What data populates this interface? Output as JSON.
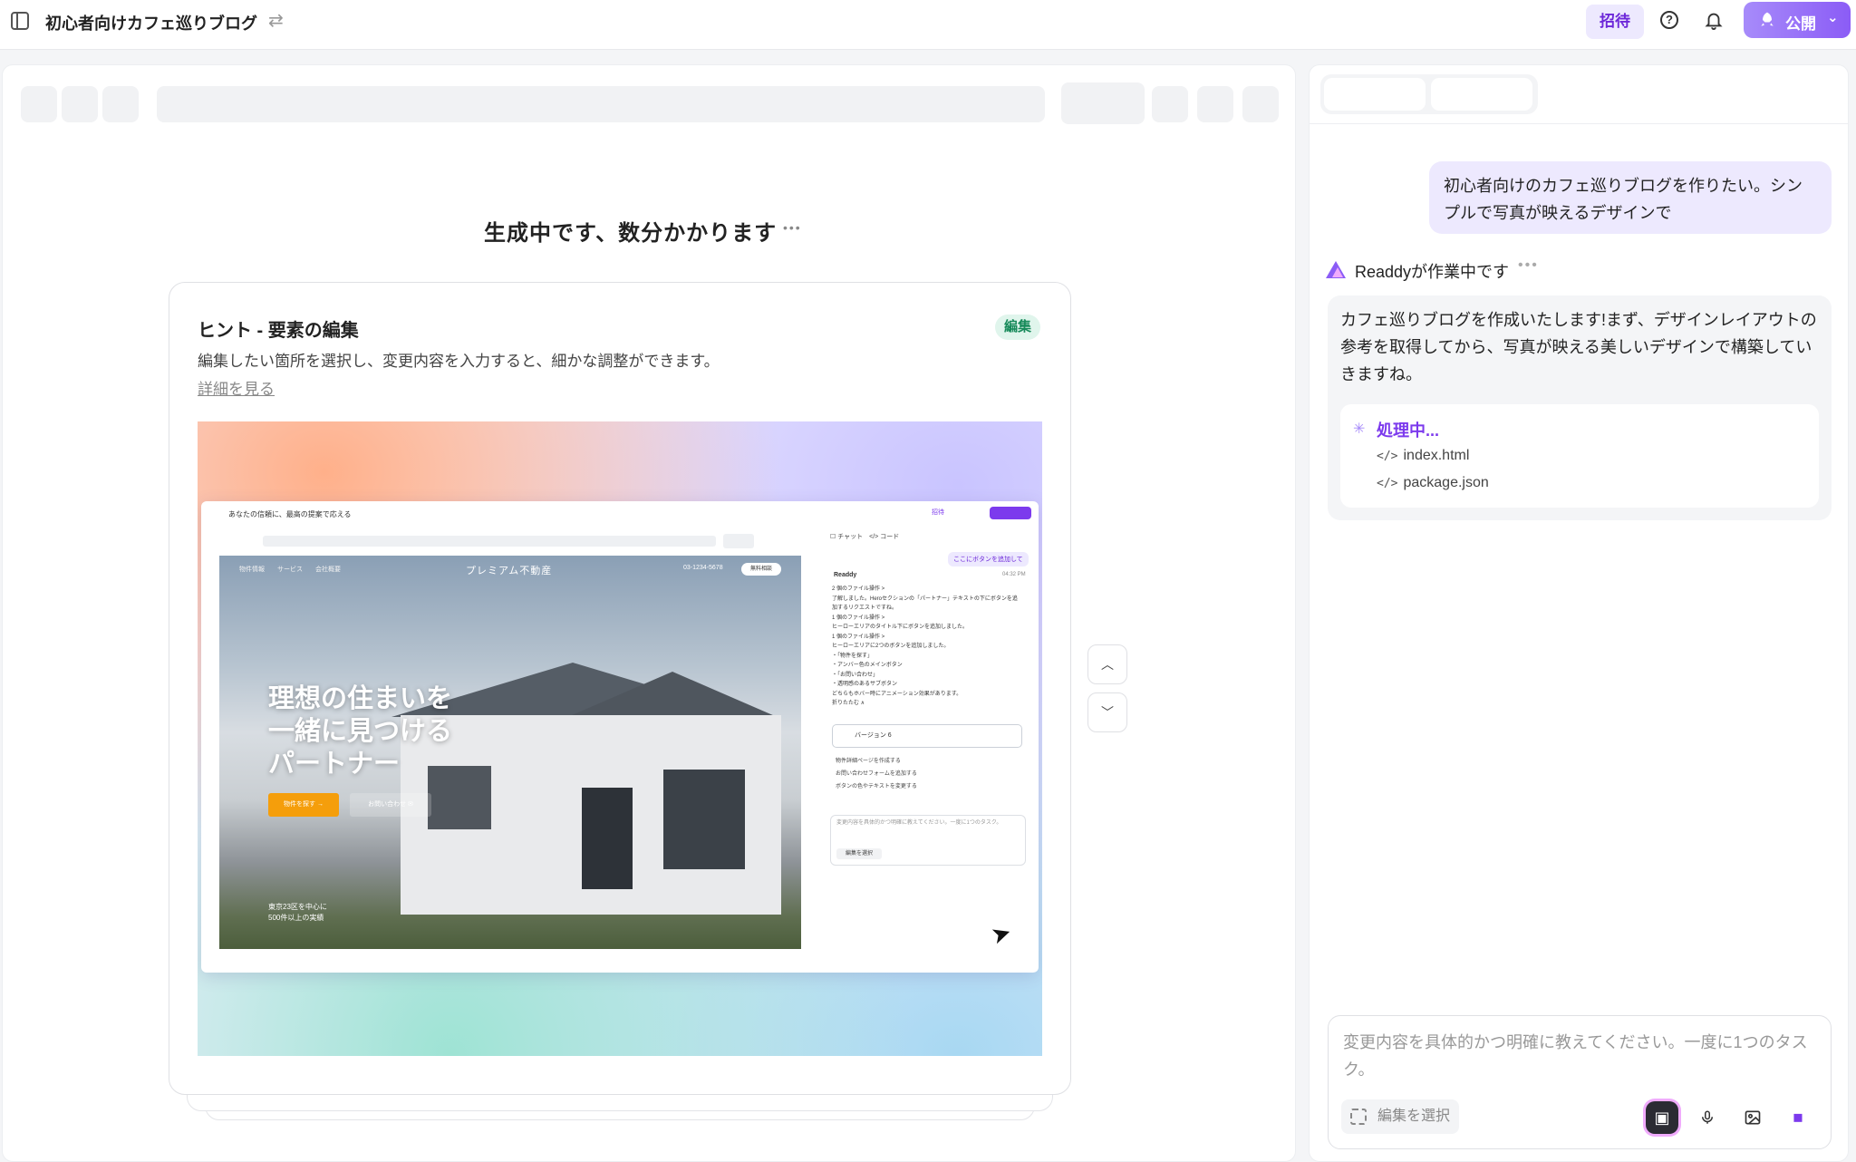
{
  "topbar": {
    "title": "初心者向けカフェ巡りブログ",
    "invite_label": "招待",
    "publish_label": "公開"
  },
  "preview": {
    "generating_text": "生成中です、数分かかります"
  },
  "hint": {
    "title": "ヒント - 要素の編集",
    "badge": "編集",
    "description": "編集したい箇所を選択し、変更内容を入力すると、細かな調整ができます。",
    "link": "詳細を見る"
  },
  "demo": {
    "window_title": "あなたの信頼に、最高の提案で応える",
    "invite": "招待",
    "nav": "物件情報　　サービス　　会社概要",
    "brand": "プレミアム不動産",
    "tel": "03-1234-5678",
    "cta": "無料相談",
    "headline": "理想の住まいを\n一緒に見つける\nパートナー",
    "btn_primary": "物件を探す →",
    "btn_secondary": "お問い合わせ ✉",
    "footer_note": "東京23区を中心に\n500件以上の実績",
    "chat_tabs": "☐ チャット　</> コード",
    "chat_bubble": "ここにボタンを追加して",
    "chat_name": "Readdy",
    "chat_time": "04:32 PM",
    "chat_lines": "2 個のファイル操作 >\n了解しました。Heroセクションの「パートナー」テキストの下にボタンを追加するリクエストですね。\n1 個のファイル操作 >\nヒーローエリアのタイトル下にボタンを追加しました。\n1 個のファイル操作 >\nヒーローエリアに2つのボタンを追加しました。\n・「物件を探す」\n・アンバー色のメインボタン\n・「お問い合わせ」\n・透明感のあるサブボタン\nどちらもホバー時にアニメーション効果があります。\n折りたたむ ∧",
    "version": "バージョン 6",
    "suggestions": "物件詳細ページを作成する\nお問い合わせフォームを追加する\nボタンの色やテキストを変更する",
    "input_placeholder": "変更内容を具体的かつ明確に教えてください。一度に1つのタスク。",
    "input_btn": "編集を選択"
  },
  "chat": {
    "user_message": "初心者向けのカフェ巡りブログを作りたい。シンプルで写真が映えるデザインで",
    "ai_status": "Readdyが作業中です",
    "ai_message": "カフェ巡りブログを作成いたします!まず、デザインレイアウトの参考を取得してから、写真が映える美しいデザインで構築していきますね。",
    "processing_label": "処理中...",
    "files": [
      "index.html",
      "package.json"
    ],
    "input_placeholder": "変更内容を具体的かつ明確に教えてください。一度に1つのタスク。",
    "edit_select_label": "編集を選択"
  },
  "colors": {
    "accent": "#7c3aed",
    "accent_light": "#ede9fe",
    "badge_green": "#178a5a"
  },
  "icons": [
    "panel-toggle-icon",
    "swap-icon",
    "help-icon",
    "bell-icon",
    "rocket-icon",
    "chevron-down-icon",
    "chevron-up-icon",
    "code-icon",
    "spinner-icon",
    "select-element-icon",
    "microphone-icon",
    "image-icon",
    "stop-icon"
  ]
}
